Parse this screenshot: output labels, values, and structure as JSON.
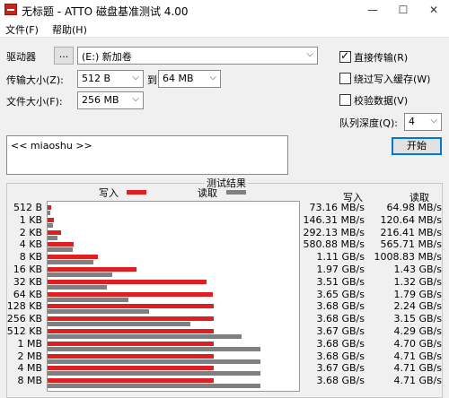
{
  "window": {
    "title": "无标题 - ATTO 磁盘基准测试 4.00",
    "minimize": "—",
    "maximize": "☐",
    "close": "✕"
  },
  "menu": {
    "file": "文件(F)",
    "help": "帮助(H)"
  },
  "settings": {
    "drive_label": "驱动器",
    "browse": "...",
    "drive_value": "(E:) 新加卷",
    "transfer_label": "传输大小(Z):",
    "transfer_from": "512 B",
    "to_label": "到",
    "transfer_to": "64 MB",
    "file_label": "文件大小(F):",
    "file_size": "256 MB",
    "direct_io": "直接传输(R)",
    "bypass_cache": "绕过写入缓存(W)",
    "verify": "校验数据(V)",
    "queue_label": "队列深度(Q):",
    "queue_value": "4",
    "start": "开始",
    "description": "<< miaoshu >>"
  },
  "results": {
    "title": "测试结果",
    "legend_write": "写入",
    "legend_read": "读取",
    "col_write": "写入",
    "col_read": "读取",
    "colors": {
      "write": "#e02020",
      "read": "#808080"
    }
  },
  "chart_data": {
    "type": "bar",
    "categories": [
      "512 B",
      "1 KB",
      "2 KB",
      "4 KB",
      "8 KB",
      "16 KB",
      "32 KB",
      "64 KB",
      "128 KB",
      "256 KB",
      "512 KB",
      "1 MB",
      "2 MB",
      "4 MB",
      "8 MB"
    ],
    "series": [
      {
        "name": "写入",
        "values": [
          73.16,
          146.31,
          292.13,
          580.88,
          1110,
          1970,
          3510,
          3650,
          3680,
          3680,
          3670,
          3680,
          3680,
          3670,
          3680
        ],
        "labels": [
          "73.16 MB/s",
          "146.31 MB/s",
          "292.13 MB/s",
          "580.88 MB/s",
          "1.11 GB/s",
          "1.97 GB/s",
          "3.51 GB/s",
          "3.65 GB/s",
          "3.68 GB/s",
          "3.68 GB/s",
          "3.67 GB/s",
          "3.68 GB/s",
          "3.68 GB/s",
          "3.67 GB/s",
          "3.68 GB/s"
        ]
      },
      {
        "name": "读取",
        "values": [
          64.98,
          120.64,
          216.41,
          565.71,
          1008.83,
          1430,
          1320,
          1790,
          2240,
          3150,
          4290,
          4700,
          4710,
          4710,
          4710
        ],
        "labels": [
          "64.98 MB/s",
          "120.64 MB/s",
          "216.41 MB/s",
          "565.71 MB/s",
          "1008.83 MB/s",
          "1.43 GB/s",
          "1.32 GB/s",
          "1.79 GB/s",
          "2.24 GB/s",
          "3.15 GB/s",
          "4.29 GB/s",
          "4.70 GB/s",
          "4.71 GB/s",
          "4.71 GB/s",
          "4.71 GB/s"
        ]
      }
    ],
    "unit": "MB/s",
    "xlim": [
      0,
      5600
    ]
  }
}
